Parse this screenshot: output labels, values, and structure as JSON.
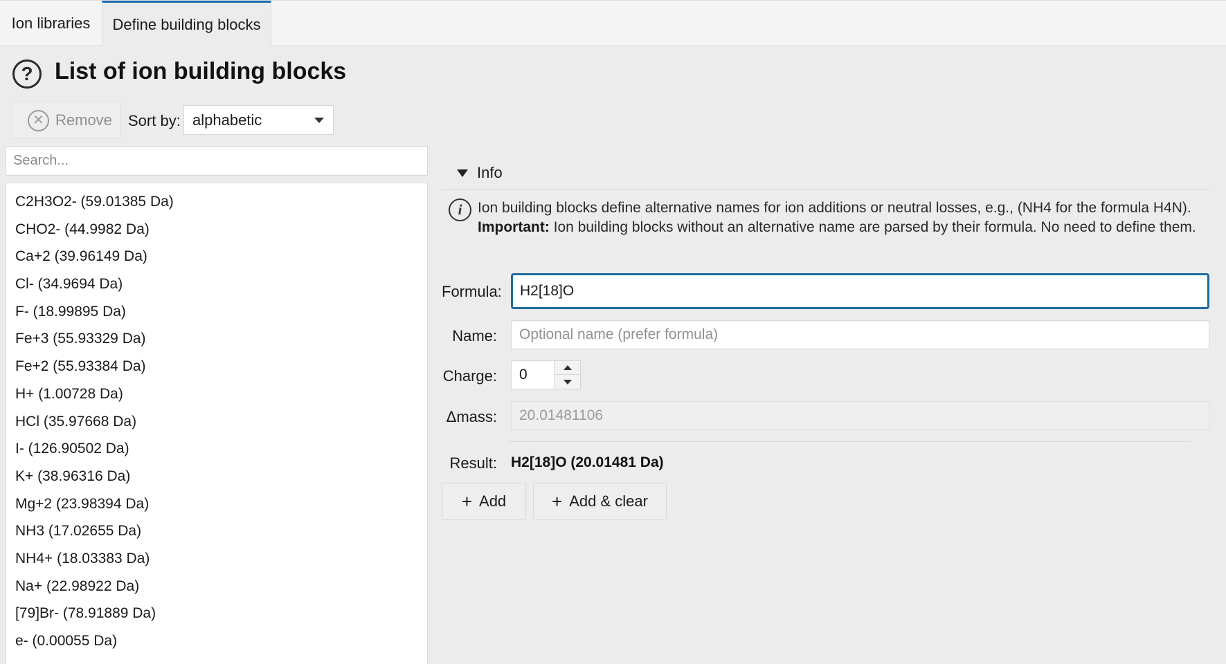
{
  "tabs": [
    {
      "label": "Ion libraries"
    },
    {
      "label": "Define building blocks"
    }
  ],
  "header": {
    "title": "List of ion building blocks"
  },
  "toolbar": {
    "remove_label": "Remove",
    "sort_label": "Sort by:",
    "sort_value": "alphabetic"
  },
  "search": {
    "placeholder": "Search..."
  },
  "list": {
    "items": [
      "C2H3O2- (59.01385 Da)",
      "CHO2- (44.9982 Da)",
      "Ca+2 (39.96149 Da)",
      "Cl- (34.9694 Da)",
      "F- (18.99895 Da)",
      "Fe+3 (55.93329 Da)",
      "Fe+2 (55.93384 Da)",
      "H+ (1.00728 Da)",
      "HCl (35.97668 Da)",
      "I- (126.90502 Da)",
      "K+ (38.96316 Da)",
      "Mg+2 (23.98394 Da)",
      "NH3 (17.02655 Da)",
      "NH4+ (18.03383 Da)",
      "Na+ (22.98922 Da)",
      "[79]Br- (78.91889 Da)",
      "e- (0.00055 Da)"
    ]
  },
  "info": {
    "header": "Info",
    "line1": "Ion building blocks define alternative names for ion additions or neutral losses, e.g., (NH4 for the formula H4N).",
    "important_label": "Important:",
    "line2": " Ion building blocks without an alternative name are parsed by their formula. No need to define them."
  },
  "form": {
    "formula_label": "Formula:",
    "formula_value": "H2[18]O",
    "name_label": "Name:",
    "name_placeholder": "Optional name (prefer formula)",
    "charge_label": "Charge:",
    "charge_value": "0",
    "mass_label": "Δmass:",
    "mass_value": "20.01481106",
    "result_label": "Result:",
    "result_value": "H2[18]O (20.01481 Da)"
  },
  "buttons": {
    "add_label": "Add",
    "add_clear_label": "Add & clear"
  },
  "colors": {
    "accent": "#1f6fb2",
    "focus_border": "#1f6a9e"
  }
}
